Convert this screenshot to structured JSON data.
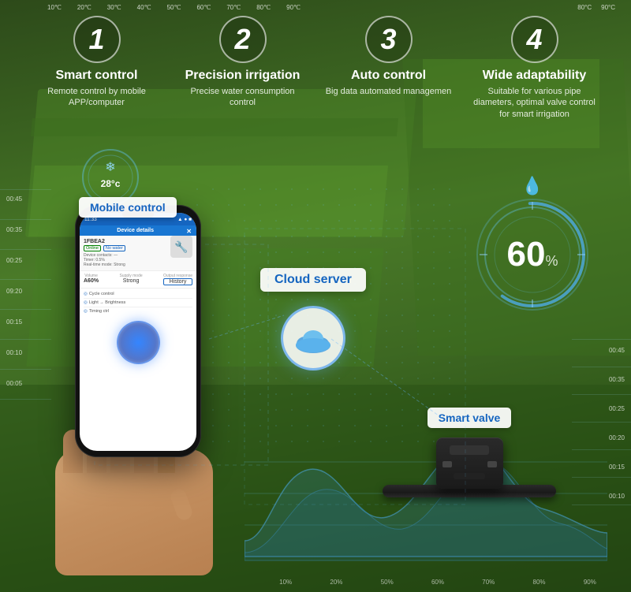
{
  "background": {
    "color": "#3d6b25"
  },
  "top_temps": {
    "labels": [
      "10℃",
      "20℃",
      "30℃",
      "40℃",
      "50℃",
      "60℃",
      "70℃",
      "80℃",
      "90℃"
    ]
  },
  "features": [
    {
      "number": "1",
      "title": "Smart control",
      "description": "Remote control by mobile APP/computer"
    },
    {
      "number": "2",
      "title": "Precision irrigation",
      "description": "Precise water consumption control"
    },
    {
      "number": "3",
      "title": "Auto control",
      "description": "Big data automated managemen"
    },
    {
      "number": "4",
      "title": "Wide adaptability",
      "description": "Suitable for various pipe diameters, optimal valve control for smart irrigation"
    }
  ],
  "mobile_label": "Mobile control",
  "phone": {
    "time": "11:33",
    "screen_title": "Device details",
    "device_name": "1FBEA2",
    "status_text": "Online",
    "status_text2": "No water",
    "fields": [
      {
        "label": "Device contacts",
        "value": ""
      },
      {
        "label": "Timer",
        "value": "0.5%"
      },
      {
        "label": "Real-time mode",
        "value": "Strong"
      },
      {
        "label": "Control",
        "value": ""
      },
      {
        "label": "History",
        "value": ""
      }
    ]
  },
  "cloud_server_label": "Cloud server",
  "smart_valve_label": "Smart valve",
  "humidity": {
    "value": "60",
    "unit": "%"
  },
  "left_chart_labels": [
    "00:45",
    "00:35",
    "00:25",
    "09:20",
    "00:15",
    "00:10",
    "00:05"
  ],
  "right_chart_labels": [
    "00:45",
    "00:35",
    "00:25",
    "00:20",
    "00:15",
    "00:10"
  ],
  "bottom_x_labels": [
    "10%",
    "20%",
    "50%",
    "60%",
    "70%",
    "80%",
    "90%"
  ],
  "top_right_x_labels": [
    "80°C",
    "90°C"
  ]
}
